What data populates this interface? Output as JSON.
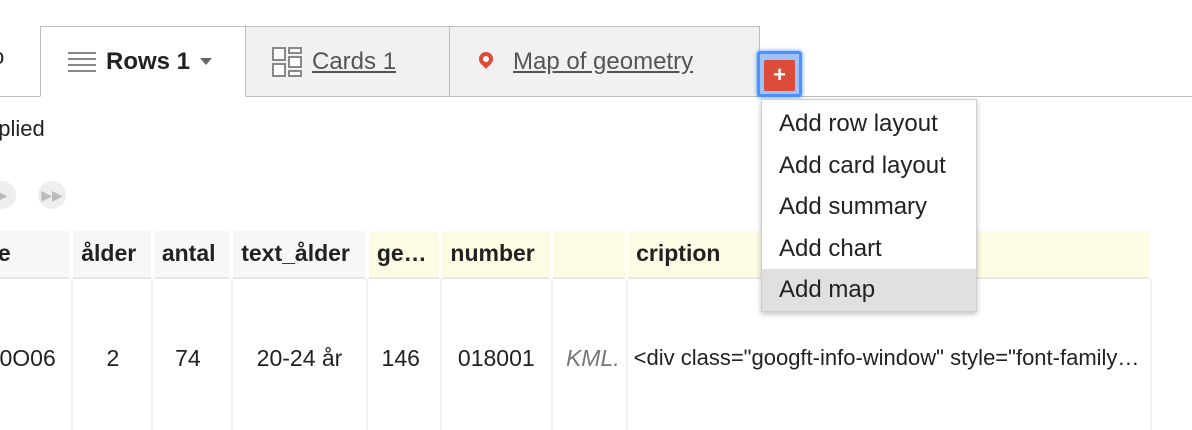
{
  "tabs": {
    "left_stub": "o",
    "rows": {
      "label": "Rows 1",
      "icon": "rows-icon"
    },
    "cards": {
      "label": "Cards 1",
      "icon": "cards-icon"
    },
    "map": {
      "label": "Map of geometry",
      "icon": "map-pin-icon"
    },
    "add": {
      "label": "+"
    }
  },
  "filter": {
    "status": "pplied"
  },
  "pager": {
    "prev_icon": "play-icon",
    "next_icon": "fast-forward-icon"
  },
  "table": {
    "columns": [
      "åde",
      "ålder",
      "antal",
      "text_ålder",
      "ge…",
      "number",
      "",
      "cription"
    ],
    "row": {
      "c0": "0O06",
      "c1": "2",
      "c2": "74",
      "c3": "20-24 år",
      "c4": "146",
      "c5": "018001",
      "c6": "KML.",
      "c7": "<div class=\"googft-info-window\" style=\"font-family…"
    }
  },
  "menu": {
    "items": [
      "Add row layout",
      "Add card layout",
      "Add summary",
      "Add chart",
      "Add map"
    ],
    "highlighted": "Add map"
  },
  "colors": {
    "accent_red": "#dd4b39",
    "focus_blue": "#4d90fe",
    "header_highlight": "#fcfbe3"
  }
}
